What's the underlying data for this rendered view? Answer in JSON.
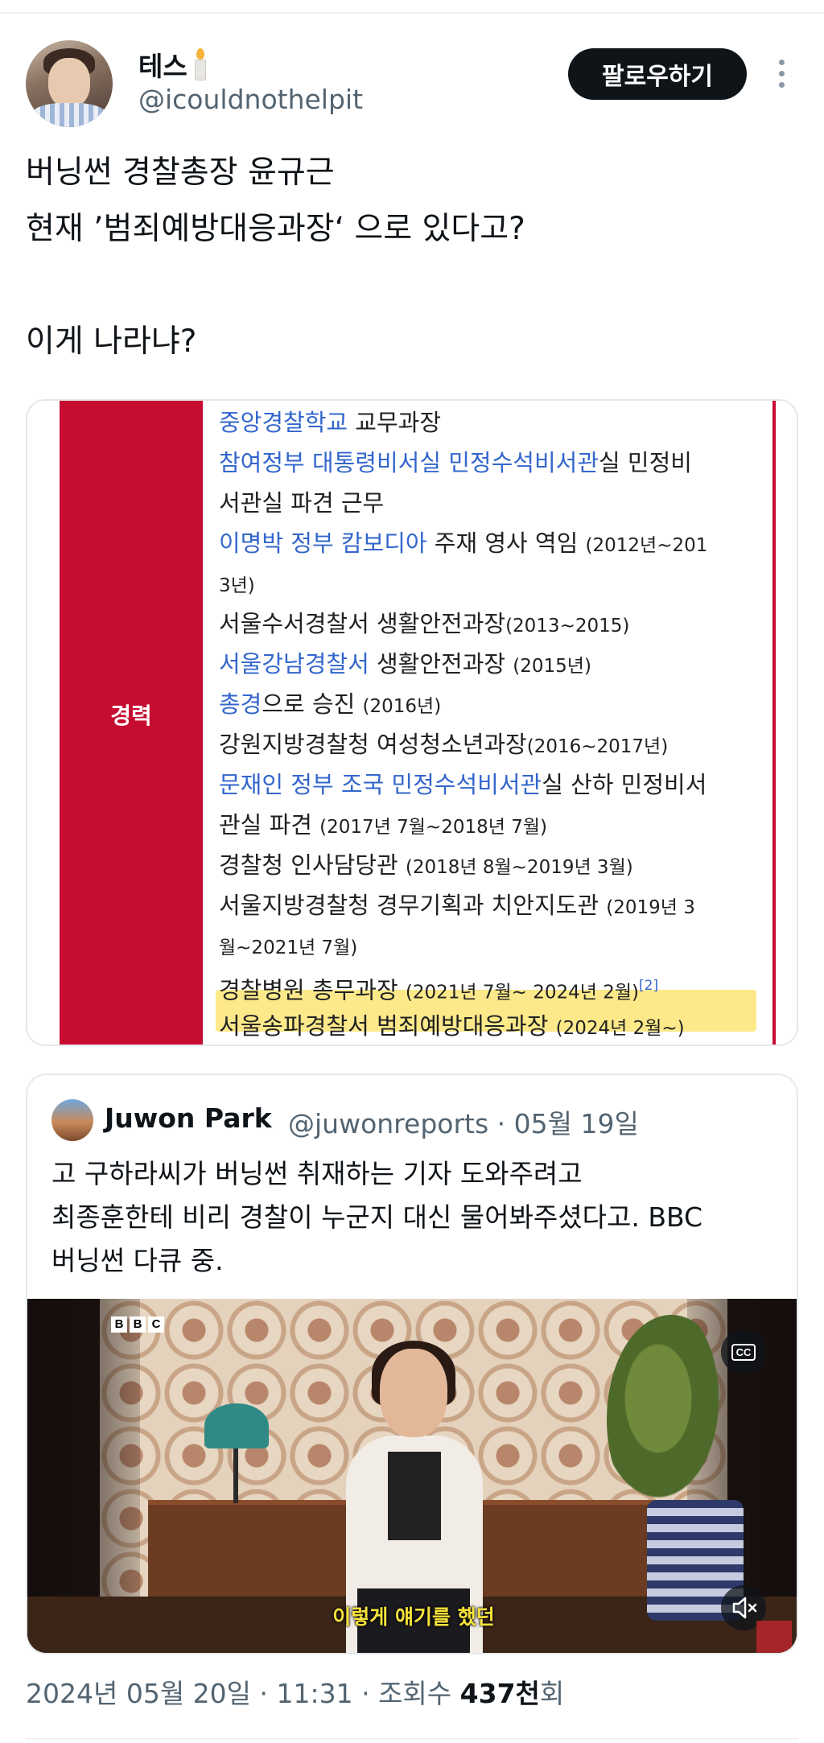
{
  "author": {
    "display_name": "테스",
    "handle": "@icouldnothelpit",
    "follow_label": "팔로우하기"
  },
  "tweet": {
    "text": "버닝썬 경찰총장 윤규근\n현재 ’범죄예방대응과장‘ 으로 있다고?\n\n이게 나라냐?"
  },
  "career_card": {
    "row_label": "경력",
    "lines": [
      {
        "link": "중앙경찰학교",
        "rest": " 교무과장",
        "period": ""
      },
      {
        "link": "참여정부 대통령비서실 민정수석비서관",
        "rest": "실 민정비",
        "period": ""
      },
      {
        "link": "",
        "rest": "서관실 파견 근무",
        "period": ""
      },
      {
        "link": "이명박 정부 캄보디아",
        "rest": " 주재 영사 역임 ",
        "period": "(2012년~201"
      },
      {
        "link": "",
        "rest": "",
        "period": "3년)"
      },
      {
        "link": "",
        "rest": "서울수서경찰서 생활안전과장",
        "period": "(2013~2015)"
      },
      {
        "link": "서울강남경찰서",
        "rest": " 생활안전과장 ",
        "period": "(2015년)"
      },
      {
        "link": "총경",
        "rest": "으로 승진 ",
        "period": "(2016년)"
      },
      {
        "link": "",
        "rest": "강원지방경찰청 여성청소년과장",
        "period": "(2016~2017년)"
      },
      {
        "link": "문재인 정부 조국 민정수석비서관",
        "rest": "실 산하 민정비서",
        "period": ""
      },
      {
        "link": "",
        "rest": "관실 파견 ",
        "period": "(2017년 7월~2018년 7월)"
      },
      {
        "link": "",
        "rest": "경찰청 인사담당관 ",
        "period": "(2018년 8월~2019년 3월)"
      },
      {
        "link": "",
        "rest": "서울지방경찰청 경무기획과 치안지도관 ",
        "period": "(2019년 3"
      },
      {
        "link": "",
        "rest": "",
        "period": "월~2021년 7월)"
      },
      {
        "link": "",
        "rest": "경찰병원 총무과장 ",
        "period": "(2021년 7월~ 2024년 2월)",
        "ref": "[2]"
      },
      {
        "link": "",
        "rest": "서울송파경찰서 범죄예방대응과장 ",
        "period": "(2024년 2월~)"
      }
    ]
  },
  "quoted_tweet": {
    "name": "Juwon Park",
    "handle_date": "@juwonreports · 05월 19일",
    "text": "고 구하라씨가 버닝썬 취재하는 기자 도와주려고\n최종훈한테 비리 경찰이 누군지 대신 물어봐주셨다고. BBC\n버닝썬 다큐 중.",
    "video": {
      "logo_letters": [
        "B",
        "B",
        "C"
      ],
      "cc_label": "CC",
      "subtitle": "이렇게 얘기를 했던"
    }
  },
  "footer": {
    "timestamp": "2024년 05월 20일 · 11:31 · 조회수 ",
    "views_count": "437천",
    "views_suffix": "회"
  },
  "colors": {
    "wiki_red": "#c60c30",
    "wiki_link": "#3366cc",
    "highlight": "#fde98a",
    "follow_bg": "#0f1419",
    "muted_text": "#536471",
    "subtitle": "#f6e23b"
  },
  "icons": [
    "candle-icon",
    "more-icon",
    "cc-icon",
    "mute-icon"
  ]
}
